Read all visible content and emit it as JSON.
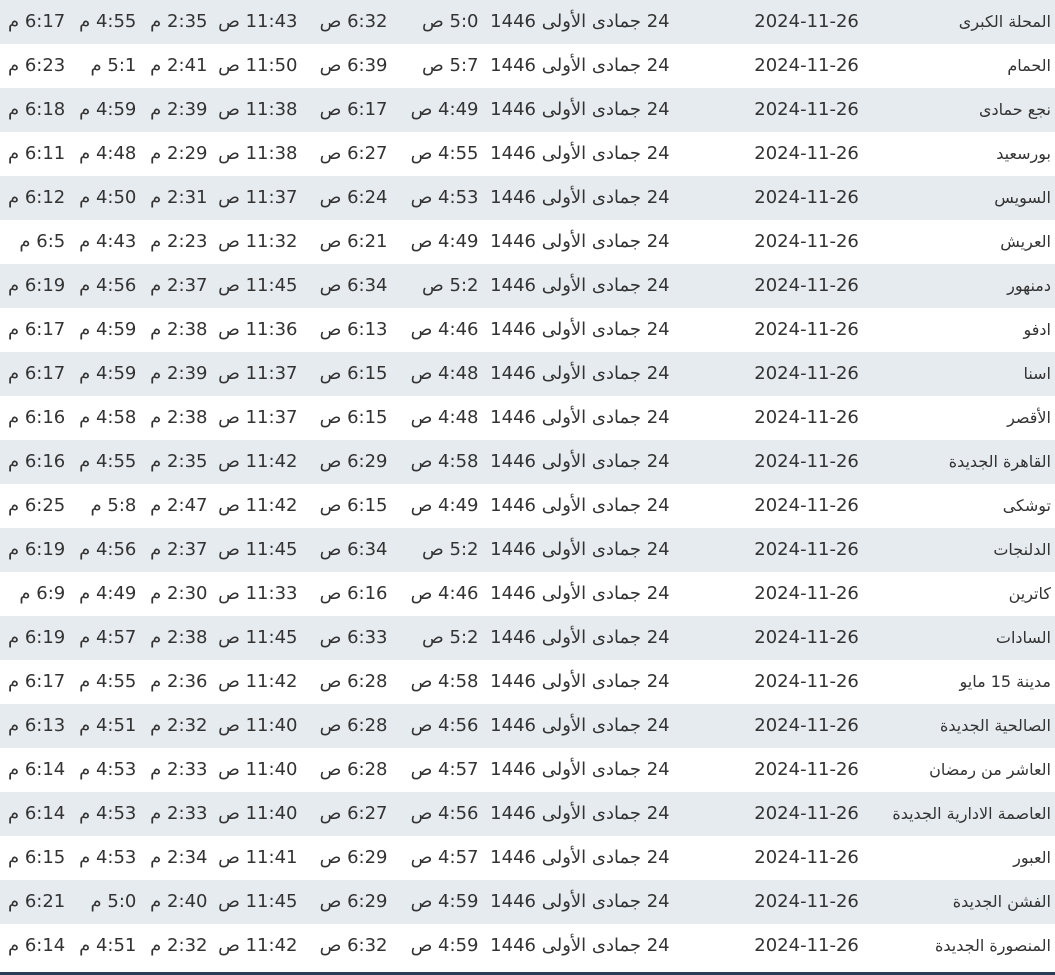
{
  "rows": [
    {
      "city": "المحلة الكبرى",
      "date": "2024-11-26",
      "hijri": "24 جمادى الأولى 1446",
      "fajr": "5:0 ص",
      "sunrise": "6:32 ص",
      "dhuhr": "11:43 ص",
      "asr": "2:35 م",
      "maghrib": "4:55 م",
      "isha": "6:17 م"
    },
    {
      "city": "الحمام",
      "date": "2024-11-26",
      "hijri": "24 جمادى الأولى 1446",
      "fajr": "5:7 ص",
      "sunrise": "6:39 ص",
      "dhuhr": "11:50 ص",
      "asr": "2:41 م",
      "maghrib": "5:1 م",
      "isha": "6:23 م"
    },
    {
      "city": "نجع حمادى",
      "date": "2024-11-26",
      "hijri": "24 جمادى الأولى 1446",
      "fajr": "4:49 ص",
      "sunrise": "6:17 ص",
      "dhuhr": "11:38 ص",
      "asr": "2:39 م",
      "maghrib": "4:59 م",
      "isha": "6:18 م"
    },
    {
      "city": "بورسعيد",
      "date": "2024-11-26",
      "hijri": "24 جمادى الأولى 1446",
      "fajr": "4:55 ص",
      "sunrise": "6:27 ص",
      "dhuhr": "11:38 ص",
      "asr": "2:29 م",
      "maghrib": "4:48 م",
      "isha": "6:11 م"
    },
    {
      "city": "السويس",
      "date": "2024-11-26",
      "hijri": "24 جمادى الأولى 1446",
      "fajr": "4:53 ص",
      "sunrise": "6:24 ص",
      "dhuhr": "11:37 ص",
      "asr": "2:31 م",
      "maghrib": "4:50 م",
      "isha": "6:12 م"
    },
    {
      "city": "العريش",
      "date": "2024-11-26",
      "hijri": "24 جمادى الأولى 1446",
      "fajr": "4:49 ص",
      "sunrise": "6:21 ص",
      "dhuhr": "11:32 ص",
      "asr": "2:23 م",
      "maghrib": "4:43 م",
      "isha": "6:5 م"
    },
    {
      "city": "دمنهور",
      "date": "2024-11-26",
      "hijri": "24 جمادى الأولى 1446",
      "fajr": "5:2 ص",
      "sunrise": "6:34 ص",
      "dhuhr": "11:45 ص",
      "asr": "2:37 م",
      "maghrib": "4:56 م",
      "isha": "6:19 م"
    },
    {
      "city": "ادفو",
      "date": "2024-11-26",
      "hijri": "24 جمادى الأولى 1446",
      "fajr": "4:46 ص",
      "sunrise": "6:13 ص",
      "dhuhr": "11:36 ص",
      "asr": "2:38 م",
      "maghrib": "4:59 م",
      "isha": "6:17 م"
    },
    {
      "city": "اسنا",
      "date": "2024-11-26",
      "hijri": "24 جمادى الأولى 1446",
      "fajr": "4:48 ص",
      "sunrise": "6:15 ص",
      "dhuhr": "11:37 ص",
      "asr": "2:39 م",
      "maghrib": "4:59 م",
      "isha": "6:17 م"
    },
    {
      "city": "الأقصر",
      "date": "2024-11-26",
      "hijri": "24 جمادى الأولى 1446",
      "fajr": "4:48 ص",
      "sunrise": "6:15 ص",
      "dhuhr": "11:37 ص",
      "asr": "2:38 م",
      "maghrib": "4:58 م",
      "isha": "6:16 م"
    },
    {
      "city": "القاهرة الجديدة",
      "date": "2024-11-26",
      "hijri": "24 جمادى الأولى 1446",
      "fajr": "4:58 ص",
      "sunrise": "6:29 ص",
      "dhuhr": "11:42 ص",
      "asr": "2:35 م",
      "maghrib": "4:55 م",
      "isha": "6:16 م"
    },
    {
      "city": "توشكى",
      "date": "2024-11-26",
      "hijri": "24 جمادى الأولى 1446",
      "fajr": "4:49 ص",
      "sunrise": "6:15 ص",
      "dhuhr": "11:42 ص",
      "asr": "2:47 م",
      "maghrib": "5:8 م",
      "isha": "6:25 م"
    },
    {
      "city": "الدلنجات",
      "date": "2024-11-26",
      "hijri": "24 جمادى الأولى 1446",
      "fajr": "5:2 ص",
      "sunrise": "6:34 ص",
      "dhuhr": "11:45 ص",
      "asr": "2:37 م",
      "maghrib": "4:56 م",
      "isha": "6:19 م"
    },
    {
      "city": "كاترين",
      "date": "2024-11-26",
      "hijri": "24 جمادى الأولى 1446",
      "fajr": "4:46 ص",
      "sunrise": "6:16 ص",
      "dhuhr": "11:33 ص",
      "asr": "2:30 م",
      "maghrib": "4:49 م",
      "isha": "6:9 م"
    },
    {
      "city": "السادات",
      "date": "2024-11-26",
      "hijri": "24 جمادى الأولى 1446",
      "fajr": "5:2 ص",
      "sunrise": "6:33 ص",
      "dhuhr": "11:45 ص",
      "asr": "2:38 م",
      "maghrib": "4:57 م",
      "isha": "6:19 م"
    },
    {
      "city": "مدينة 15 مايو",
      "date": "2024-11-26",
      "hijri": "24 جمادى الأولى 1446",
      "fajr": "4:58 ص",
      "sunrise": "6:28 ص",
      "dhuhr": "11:42 ص",
      "asr": "2:36 م",
      "maghrib": "4:55 م",
      "isha": "6:17 م"
    },
    {
      "city": "الصالحية الجديدة",
      "date": "2024-11-26",
      "hijri": "24 جمادى الأولى 1446",
      "fajr": "4:56 ص",
      "sunrise": "6:28 ص",
      "dhuhr": "11:40 ص",
      "asr": "2:32 م",
      "maghrib": "4:51 م",
      "isha": "6:13 م"
    },
    {
      "city": "العاشر من رمضان",
      "date": "2024-11-26",
      "hijri": "24 جمادى الأولى 1446",
      "fajr": "4:57 ص",
      "sunrise": "6:28 ص",
      "dhuhr": "11:40 ص",
      "asr": "2:33 م",
      "maghrib": "4:53 م",
      "isha": "6:14 م"
    },
    {
      "city": "العاصمة الادارية الجديدة",
      "date": "2024-11-26",
      "hijri": "24 جمادى الأولى 1446",
      "fajr": "4:56 ص",
      "sunrise": "6:27 ص",
      "dhuhr": "11:40 ص",
      "asr": "2:33 م",
      "maghrib": "4:53 م",
      "isha": "6:14 م"
    },
    {
      "city": "العبور",
      "date": "2024-11-26",
      "hijri": "24 جمادى الأولى 1446",
      "fajr": "4:57 ص",
      "sunrise": "6:29 ص",
      "dhuhr": "11:41 ص",
      "asr": "2:34 م",
      "maghrib": "4:53 م",
      "isha": "6:15 م"
    },
    {
      "city": "الفشن الجديدة",
      "date": "2024-11-26",
      "hijri": "24 جمادى الأولى 1446",
      "fajr": "4:59 ص",
      "sunrise": "6:29 ص",
      "dhuhr": "11:45 ص",
      "asr": "2:40 م",
      "maghrib": "5:0 م",
      "isha": "6:21 م"
    },
    {
      "city": "المنصورة الجديدة",
      "date": "2024-11-26",
      "hijri": "24 جمادى الأولى 1446",
      "fajr": "4:59 ص",
      "sunrise": "6:32 ص",
      "dhuhr": "11:42 ص",
      "asr": "2:32 م",
      "maghrib": "4:51 م",
      "isha": "6:14 م"
    }
  ]
}
